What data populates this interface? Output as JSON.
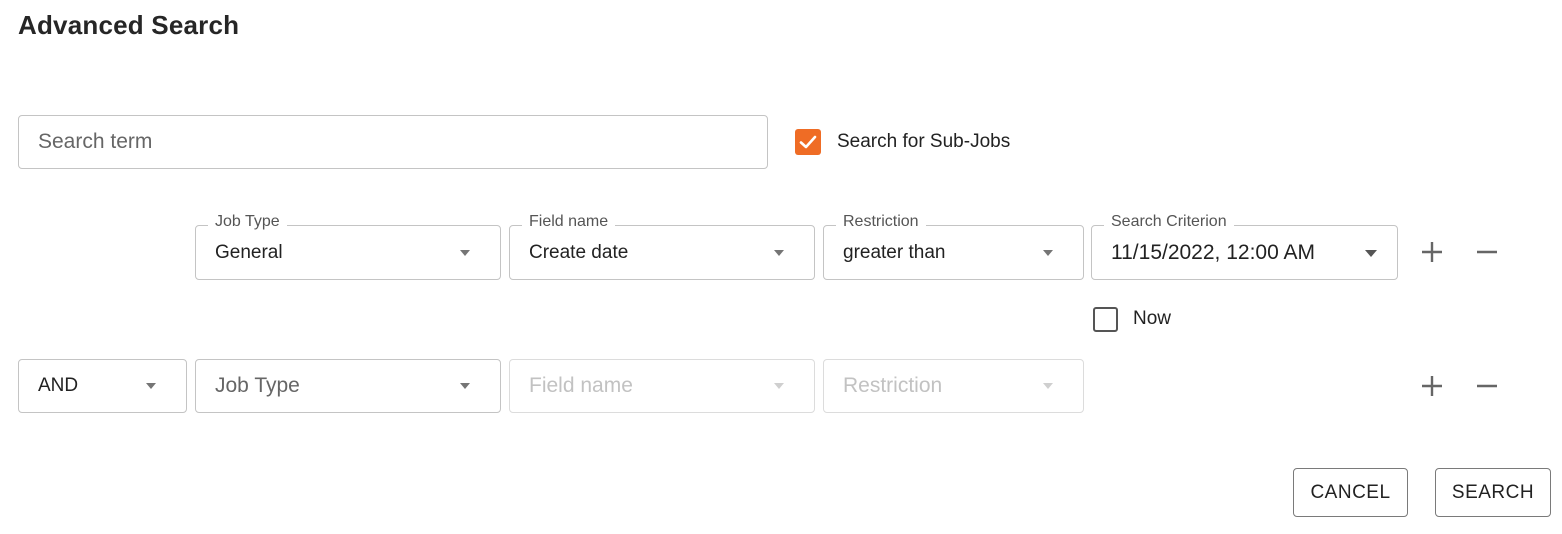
{
  "dialog": {
    "title": "Advanced Search"
  },
  "search": {
    "placeholder": "Search term",
    "value": ""
  },
  "subjobs": {
    "label": "Search for Sub-Jobs",
    "checked": true
  },
  "row1": {
    "job_type": {
      "label": "Job Type",
      "value": "General"
    },
    "field_name": {
      "label": "Field name",
      "value": "Create date"
    },
    "restriction": {
      "label": "Restriction",
      "value": "greater than"
    },
    "criterion": {
      "label": "Search Criterion",
      "value": "11/15/2022, 12:00 AM"
    },
    "now": {
      "label": "Now",
      "checked": false
    }
  },
  "row2": {
    "operator": {
      "value": "AND"
    },
    "job_type": {
      "placeholder": "Job Type"
    },
    "field_name": {
      "placeholder": "Field name",
      "disabled": true
    },
    "restriction": {
      "placeholder": "Restriction",
      "disabled": true
    }
  },
  "actions": {
    "cancel": "CANCEL",
    "search": "SEARCH"
  },
  "colors": {
    "accent": "#ef6c25",
    "border": "#c4c4c4",
    "disabled": "#c2c2c2"
  }
}
